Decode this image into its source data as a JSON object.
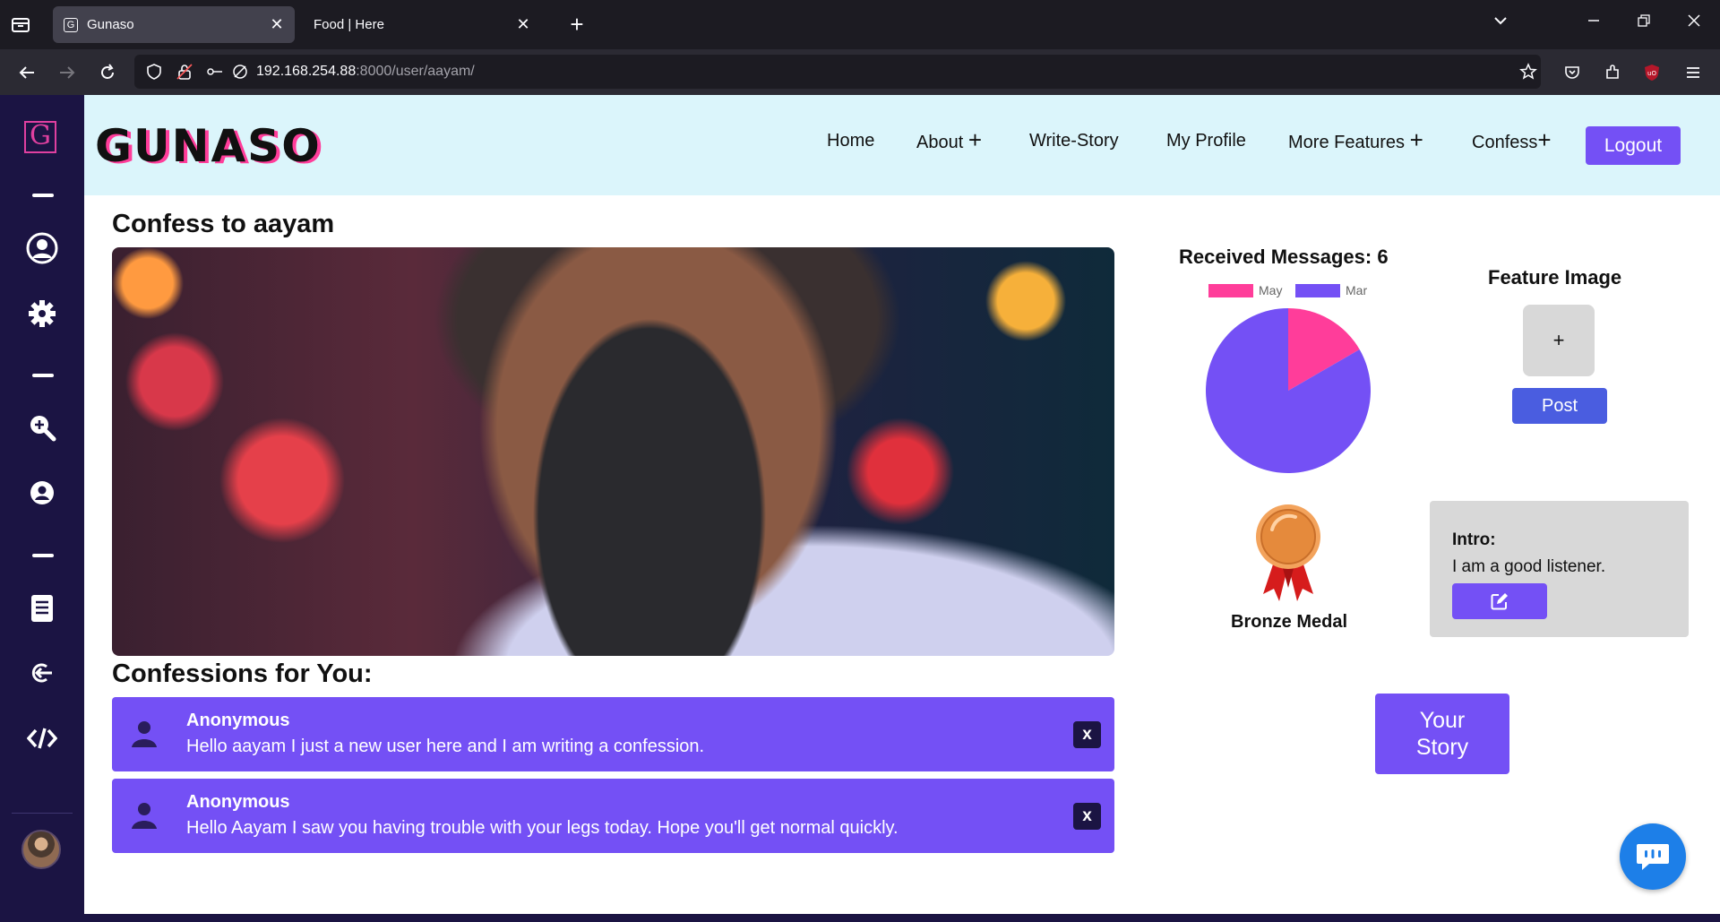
{
  "browser": {
    "tabs": [
      {
        "title": "Gunaso",
        "active": true
      },
      {
        "title": "Food | Here",
        "active": false
      }
    ],
    "url_host": "192.168.254.88",
    "url_rest": ":8000/user/aayam/"
  },
  "site": {
    "brand": "GUNASO",
    "logo_letter": "G",
    "nav": {
      "home": "Home",
      "about": "About",
      "write_story": "Write-Story",
      "my_profile": "My Profile",
      "more_features": "More Features",
      "confess": "Confess",
      "logout": "Logout",
      "plus": "+"
    }
  },
  "main": {
    "confess_heading": "Confess to aayam",
    "confessions_heading": "Confessions for You:",
    "confessions": [
      {
        "author": "Anonymous",
        "message": "Hello aayam I just a new user here and I am writing a confession.",
        "delete_label": "x"
      },
      {
        "author": "Anonymous",
        "message": "Hello Aayam I saw you having trouble with your legs today. Hope you'll get normal quickly.",
        "delete_label": "x"
      }
    ]
  },
  "stats": {
    "received_label": "Received Messages: 6"
  },
  "chart_data": {
    "type": "pie",
    "labels": [
      "May",
      "Mar"
    ],
    "values": [
      1,
      5
    ],
    "colors": [
      "#ff3d9a",
      "#7450f5"
    ],
    "legend": "top"
  },
  "feature_image": {
    "title": "Feature Image",
    "add_label": "+",
    "post_label": "Post"
  },
  "medal": {
    "label": "Bronze Medal"
  },
  "intro": {
    "title": "Intro:",
    "text": "I am a good listener."
  },
  "your_story": {
    "line1": "Your",
    "line2": "Story"
  },
  "colors": {
    "accent": "#7450f5",
    "sidebar": "#1b1443",
    "header_bg": "#dbf5fb",
    "post_button": "#4a5de0",
    "chat_button": "#1d7fe8"
  },
  "icons": {
    "sidebar": [
      "logo-icon",
      "minus-icon",
      "user-circle-icon",
      "gear-icon",
      "minus-icon",
      "search-plus-icon",
      "user-badge-icon",
      "minus-icon",
      "document-icon",
      "logout-icon",
      "code-icon"
    ]
  }
}
